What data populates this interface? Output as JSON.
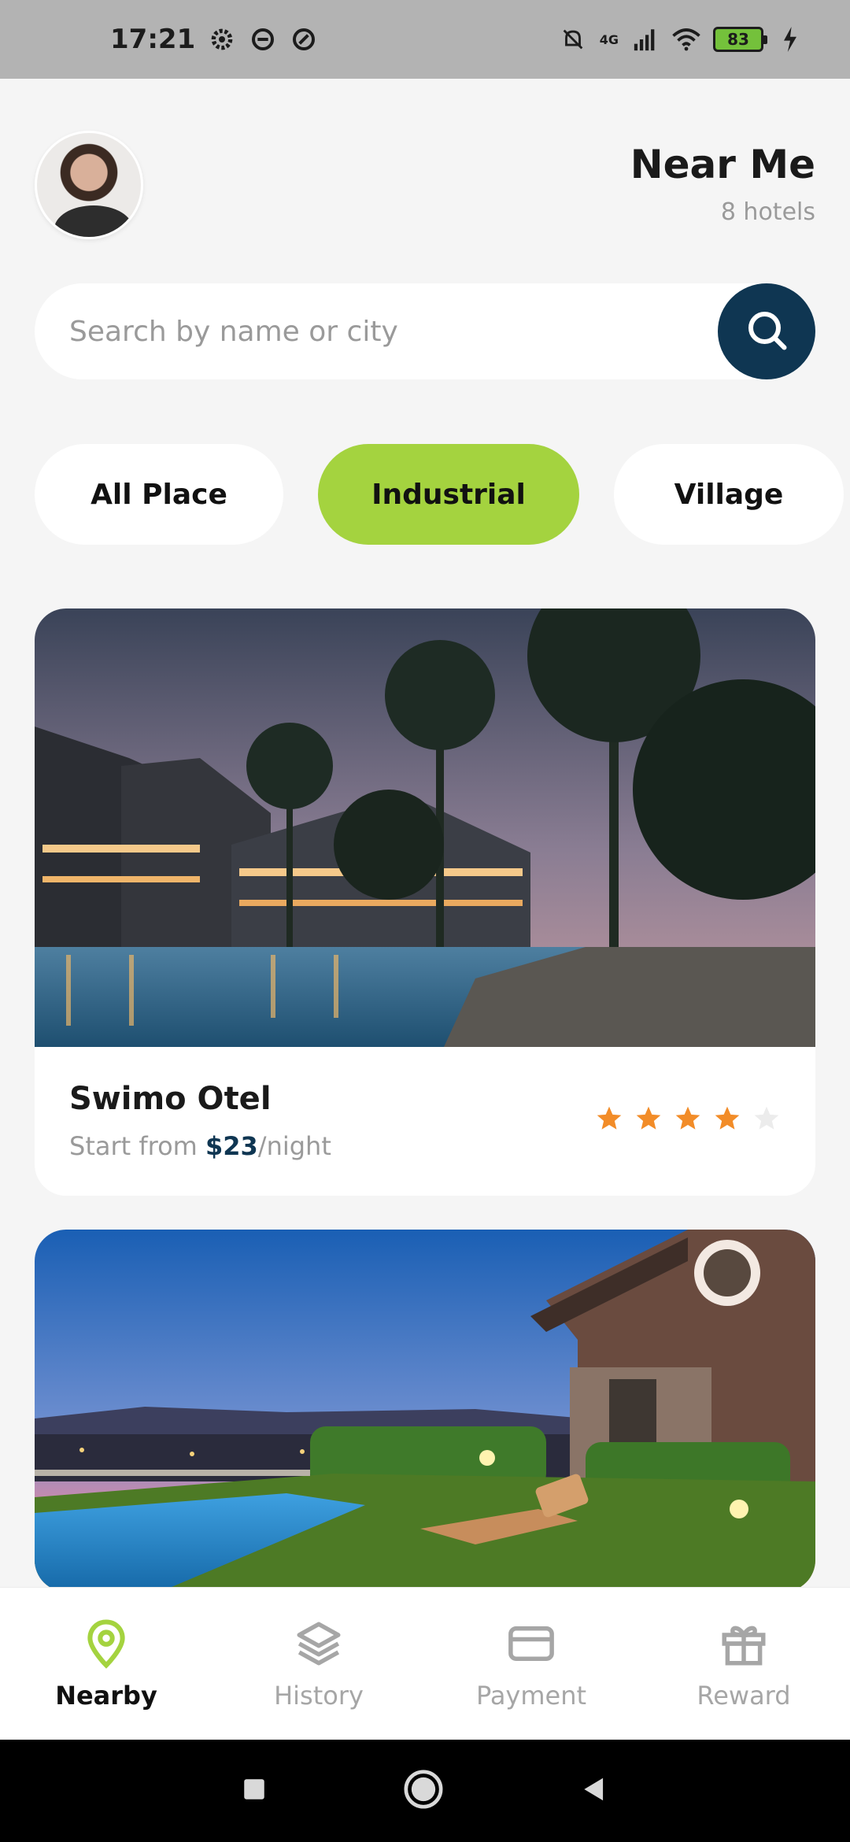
{
  "status_bar": {
    "time": "17:21",
    "network": "4G",
    "battery": "83",
    "icons": [
      "settings-icon",
      "app-icon",
      "app-icon",
      "mute-icon",
      "signal-icon",
      "wifi-icon",
      "battery-icon",
      "charging-icon"
    ]
  },
  "header": {
    "title": "Near Me",
    "subtitle": "8 hotels"
  },
  "search": {
    "placeholder": "Search by name or city",
    "value": ""
  },
  "categories": [
    {
      "label": "All Place",
      "active": false
    },
    {
      "label": "Industrial",
      "active": true
    },
    {
      "label": "Village",
      "active": false
    }
  ],
  "hotels": [
    {
      "name": "Swimo Otel",
      "price_prefix": "Start from ",
      "price": "$23",
      "price_suffix": "/night",
      "rating": 4,
      "rating_max": 5
    }
  ],
  "bottom_nav": [
    {
      "label": "Nearby",
      "icon": "location-pin-icon",
      "active": true
    },
    {
      "label": "History",
      "icon": "layers-icon",
      "active": false
    },
    {
      "label": "Payment",
      "icon": "card-icon",
      "active": false
    },
    {
      "label": "Reward",
      "icon": "gift-icon",
      "active": false
    }
  ],
  "colors": {
    "accent": "#a4d33f",
    "primary": "#0f3652",
    "star": "#f28c28",
    "star_empty": "#ececec"
  }
}
